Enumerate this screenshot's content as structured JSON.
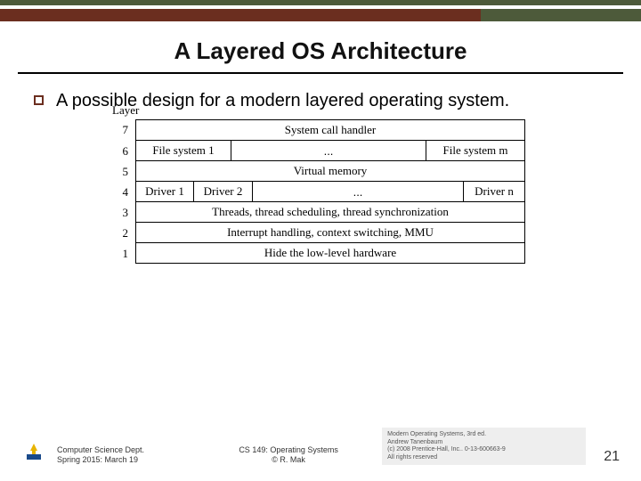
{
  "title": "A Layered OS Architecture",
  "bullet_text": "A possible design for a modern layered operating system.",
  "diagram": {
    "layer_heading": "Layer",
    "rows": {
      "r7": {
        "num": "7",
        "label": "System call handler"
      },
      "r6": {
        "num": "6",
        "a": "File system 1",
        "dots": "...",
        "b": "File system m"
      },
      "r5": {
        "num": "5",
        "label": "Virtual memory"
      },
      "r4": {
        "num": "4",
        "a": "Driver 1",
        "b": "Driver 2",
        "dots": "...",
        "c": "Driver n"
      },
      "r3": {
        "num": "3",
        "label": "Threads, thread scheduling, thread synchronization"
      },
      "r2": {
        "num": "2",
        "label": "Interrupt handling, context switching, MMU"
      },
      "r1": {
        "num": "1",
        "label": "Hide the low-level  hardware"
      }
    }
  },
  "footer": {
    "left_line1": "Computer Science Dept.",
    "left_line2": "Spring 2015: March 19",
    "mid_line1": "CS 149: Operating Systems",
    "mid_line2": "© R. Mak",
    "right_line1": "Modern Operating Systems, 3rd ed.",
    "right_line2": "Andrew Tanenbaum",
    "right_line3": "(c) 2008 Prentice-Hall, Inc.. 0-13-600663-9",
    "right_line4": "All rights reserved",
    "page": "21"
  }
}
